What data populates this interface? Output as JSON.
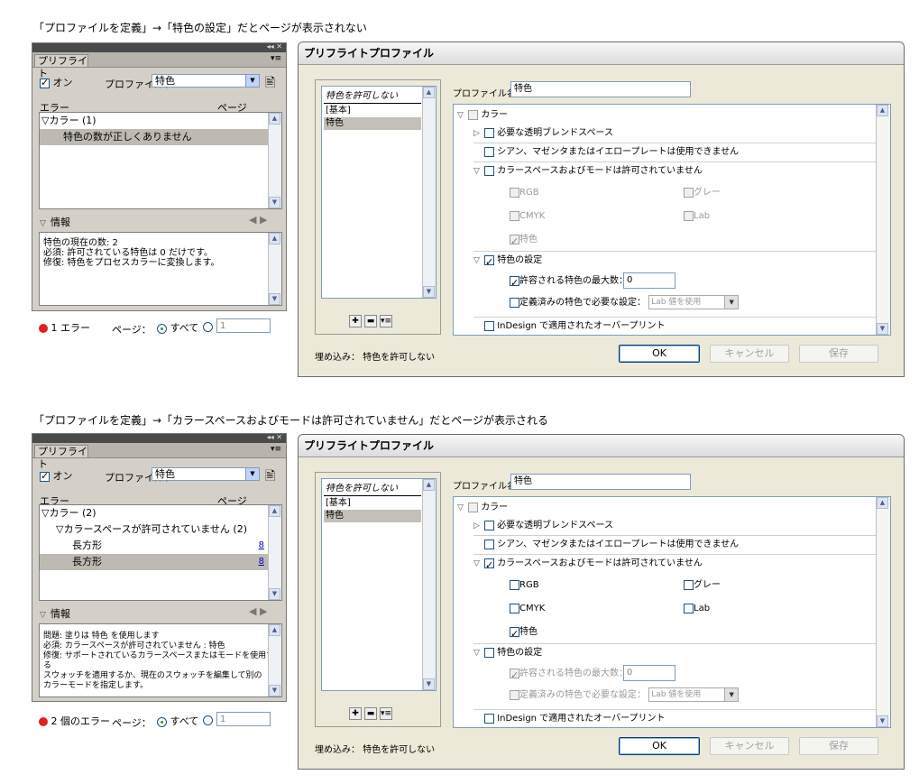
{
  "caption1": "「プロファイルを定義」→「特色の設定」だとページが表示されない",
  "caption2": "「プロファイルを定義」→「カラースペースおよびモードは許可されていません」だとページが表示される",
  "panel": {
    "tab": "プリフライト",
    "on_label": "オン",
    "profile_label": "プロファイル：",
    "profile_value": "特色",
    "col_error": "エラー",
    "col_page": "ページ",
    "info_label": "情報",
    "page_label": "ページ：",
    "all_label": "すべて",
    "page_input": "1"
  },
  "panel1": {
    "rows": [
      "▽カラー (1)",
      "特色の数が正しくありません"
    ],
    "info": [
      "特色の現在の数: 2",
      "必須: 許可されている特色は 0 だけです。",
      "修復: 特色をプロセスカラーに変換します。"
    ],
    "error_count": "1 エラー"
  },
  "panel2": {
    "rows": [
      "▽カラー (2)",
      "▽カラースペースが許可されていません (2)",
      "長方形",
      "長方形"
    ],
    "pages": [
      "8",
      "8"
    ],
    "info": [
      "問題: 塗りは 特色 を使用します",
      "必須: カラースペースが許可されていません : 特色",
      "修復: サポートされているカラースペースまたはモードを使用する",
      "スウォッチを適用するか、現在のスウォッチを編集して別の",
      "カラーモードを指定します。"
    ],
    "error_count": "2 個のエラー"
  },
  "dialog": {
    "title": "プリフライトプロファイル",
    "profiles": [
      "特色を許可しない",
      "[基本]",
      "特色"
    ],
    "name_label": "プロファイル名：",
    "name_value": "特色",
    "color": "カラー",
    "blend": "必要な透明ブレンドスペース",
    "cmy": "シアン、マゼンタまたはイエロープレートは使用できません",
    "colorspace": "カラースペースおよびモードは許可されていません",
    "rgb": "RGB",
    "gray": "グレー",
    "cmyk": "CMYK",
    "lab": "Lab",
    "spot": "特色",
    "spot_settings": "特色の設定",
    "max_spots": "許容される特色の最大数：",
    "max_value": "0",
    "predefined": "定義済みの特色で必要な設定：",
    "lab_option": "Lab 値を使用",
    "overprint": "InDesign で適用されたオーバープリント",
    "embed": "埋め込み：  特色を許可しない",
    "ok": "OK",
    "cancel": "キャンセル",
    "save": "保存"
  }
}
